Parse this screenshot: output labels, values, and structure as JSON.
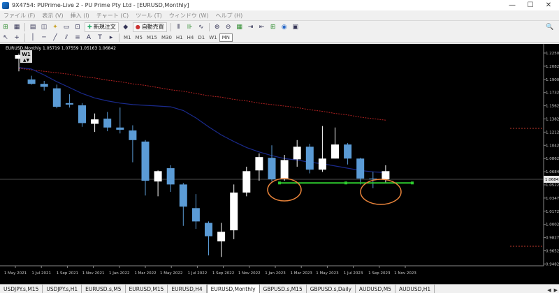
{
  "window": {
    "title": "9X4754: PUPrime-Live 2 - PU Prime Pty Ltd - [EURUSD,Monthly]",
    "minimize": "—",
    "maximize": "☐",
    "close": "✕"
  },
  "menu": [
    "ファイル (F)",
    "表示 (V)",
    "挿入 (I)",
    "チャート (C)",
    "ツール (T)",
    "ウィンドウ (W)",
    "ヘルプ (H)"
  ],
  "toolbar": {
    "new_order": "新規注文",
    "auto_trading": "自動売買"
  },
  "timeframes": [
    {
      "label": "M1",
      "active": false
    },
    {
      "label": "M5",
      "active": false
    },
    {
      "label": "M15",
      "active": false
    },
    {
      "label": "M30",
      "active": false
    },
    {
      "label": "H1",
      "active": false
    },
    {
      "label": "H4",
      "active": false
    },
    {
      "label": "D1",
      "active": false
    },
    {
      "label": "W1",
      "active": false
    },
    {
      "label": "MN",
      "active": true
    }
  ],
  "chart": {
    "info": "EURUSD,Monthly  1.05719 1.07559 1.05163 1.06842",
    "badge": "W1",
    "current_price": "1.06842",
    "price_labels": [
      "1.22500",
      "1.20820",
      "1.19000",
      "1.17320",
      "1.15620",
      "1.13820",
      "1.12120",
      "1.10420",
      "1.08620",
      "1.06842",
      "1.05220",
      "1.03470",
      "1.01720",
      "1.00020",
      "0.98270",
      "0.96520",
      "0.94820"
    ],
    "date_labels": [
      "1 May 2021",
      "1 Jul 2021",
      "1 Sep 2021",
      "1 Nov 2021",
      "1 Jan 2022",
      "1 Mar 2022",
      "1 May 2022",
      "1 Jul 2022",
      "1 Sep 2022",
      "1 Nov 2022",
      "1 Jan 2023",
      "1 Mar 2023",
      "1 May 2023",
      "1 Jul 2023",
      "1 Sep 2023",
      "1 Nov 2023"
    ]
  },
  "chart_data": {
    "type": "candlestick",
    "symbol": "EURUSD",
    "timeframe": "Monthly",
    "ylim": [
      0.94,
      1.24
    ],
    "candles": [
      {
        "o": 1.22,
        "h": 1.227,
        "l": 1.203,
        "c": 1.225
      },
      {
        "o": 1.192,
        "h": 1.197,
        "l": 1.185,
        "c": 1.186
      },
      {
        "o": 1.186,
        "h": 1.19,
        "l": 1.177,
        "c": 1.182
      },
      {
        "o": 1.18,
        "h": 1.185,
        "l": 1.153,
        "c": 1.155
      },
      {
        "o": 1.16,
        "h": 1.172,
        "l": 1.154,
        "c": 1.158
      },
      {
        "o": 1.157,
        "h": 1.16,
        "l": 1.128,
        "c": 1.133
      },
      {
        "o": 1.132,
        "h": 1.146,
        "l": 1.121,
        "c": 1.138
      },
      {
        "o": 1.139,
        "h": 1.148,
        "l": 1.122,
        "c": 1.127
      },
      {
        "o": 1.127,
        "h": 1.154,
        "l": 1.119,
        "c": 1.124
      },
      {
        "o": 1.123,
        "h": 1.13,
        "l": 1.08,
        "c": 1.11
      },
      {
        "o": 1.108,
        "h": 1.11,
        "l": 1.035,
        "c": 1.055
      },
      {
        "o": 1.054,
        "h": 1.069,
        "l": 1.034,
        "c": 1.068
      },
      {
        "o": 1.072,
        "h": 1.076,
        "l": 1.04,
        "c": 1.05
      },
      {
        "o": 1.05,
        "h": 1.052,
        "l": 0.994,
        "c": 1.02
      },
      {
        "o": 1.018,
        "h": 1.037,
        "l": 0.99,
        "c": 1.0
      },
      {
        "o": 0.998,
        "h": 1.0,
        "l": 0.954,
        "c": 0.98
      },
      {
        "o": 0.973,
        "h": 0.998,
        "l": 0.952,
        "c": 0.986
      },
      {
        "o": 0.988,
        "h": 1.05,
        "l": 0.976,
        "c": 1.039
      },
      {
        "o": 1.039,
        "h": 1.074,
        "l": 1.034,
        "c": 1.068
      },
      {
        "o": 1.069,
        "h": 1.092,
        "l": 1.055,
        "c": 1.087
      },
      {
        "o": 1.086,
        "h": 1.103,
        "l": 1.054,
        "c": 1.057
      },
      {
        "o": 1.058,
        "h": 1.09,
        "l": 1.055,
        "c": 1.083
      },
      {
        "o": 1.084,
        "h": 1.11,
        "l": 1.074,
        "c": 1.101
      },
      {
        "o": 1.101,
        "h": 1.105,
        "l": 1.065,
        "c": 1.07
      },
      {
        "o": 1.07,
        "h": 1.129,
        "l": 1.067,
        "c": 1.085
      },
      {
        "o": 1.085,
        "h": 1.127,
        "l": 1.085,
        "c": 1.104
      },
      {
        "o": 1.104,
        "h": 1.106,
        "l": 1.077,
        "c": 1.085
      },
      {
        "o": 1.085,
        "h": 1.086,
        "l": 1.05,
        "c": 1.058
      },
      {
        "o": 1.058,
        "h": 1.067,
        "l": 1.045,
        "c": 1.057
      },
      {
        "o": 1.057,
        "h": 1.076,
        "l": 1.052,
        "c": 1.068
      }
    ],
    "red_ma": [
      1.207,
      1.205,
      1.203,
      1.201,
      1.199,
      1.196,
      1.194,
      1.191,
      1.189,
      1.186,
      1.184,
      1.181,
      1.178,
      1.176,
      1.173,
      1.17,
      1.168,
      1.165,
      1.163,
      1.16,
      1.158,
      1.156,
      1.154,
      1.151,
      1.149,
      1.146,
      1.144,
      1.141,
      1.139,
      1.137
    ],
    "blue_ma": [
      1.208,
      1.206,
      1.198,
      1.189,
      1.181,
      1.173,
      1.167,
      1.163,
      1.16,
      1.158,
      1.157,
      1.156,
      1.155,
      1.15,
      1.14,
      1.128,
      1.117,
      1.108,
      1.1,
      1.094,
      1.089,
      1.085,
      1.083,
      1.08,
      1.078,
      1.075,
      1.072,
      1.069,
      1.067,
      1.066
    ],
    "support_line": 1.052,
    "colors": {
      "bull": "#ffffff",
      "bear": "#5b9bd5",
      "red_ma": "#b22222",
      "blue_ma": "#1a2a8c",
      "support": "#2ecc2e",
      "circle": "#e8833a"
    }
  },
  "tabs": [
    {
      "label": "USDJPY.s,M15",
      "active": false
    },
    {
      "label": "USDJPY.s,H1",
      "active": false
    },
    {
      "label": "EURUSD.s,M5",
      "active": false
    },
    {
      "label": "EURUSD,M15",
      "active": false
    },
    {
      "label": "EURUSD,H4",
      "active": false
    },
    {
      "label": "EURUSD,Monthly",
      "active": true
    },
    {
      "label": "GBPUSD.s,M15",
      "active": false
    },
    {
      "label": "GBPUSD.s,Daily",
      "active": false
    },
    {
      "label": "AUDUSD,M5",
      "active": false
    },
    {
      "label": "AUDUSD,H1",
      "active": false
    }
  ]
}
